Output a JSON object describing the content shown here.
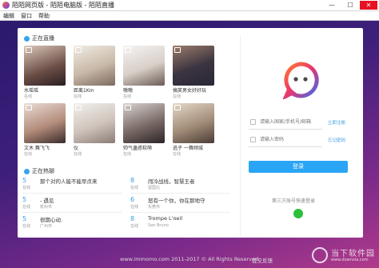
{
  "window": {
    "title": "陌陌网页版 - 陌陌电脑版 - 陌陌直播",
    "min": "—",
    "max": "☐",
    "close": "✕"
  },
  "menu": [
    "编辑",
    "窗口",
    "帮助"
  ],
  "live": {
    "title": "正在直播",
    "items": [
      {
        "name": "水瑶瑶",
        "sub": "在线"
      },
      {
        "name": "距离1Km",
        "sub": "在线"
      },
      {
        "name": "嗷嗷",
        "sub": "在线"
      },
      {
        "name": "搞笑男女好好玩",
        "sub": "在线"
      },
      {
        "name": "文木 舞飞飞",
        "sub": "在线"
      },
      {
        "name": "仪",
        "sub": "在线"
      },
      {
        "name": "帅气蛊惑软萌",
        "sub": "在线"
      },
      {
        "name": "逃子 一舞倾城",
        "sub": "在线"
      }
    ]
  },
  "hot": {
    "title": "正在热聊",
    "rows": [
      {
        "num": "5",
        "unit": "在线",
        "text": "那个对的人能不能早点来",
        "loc": ""
      },
      {
        "num": "8",
        "unit": "在线",
        "text": "闯冷战线，智慧王者",
        "loc": "留国北"
      },
      {
        "num": "5",
        "unit": "在线",
        "text": "- 遇见",
        "loc": "杭州市"
      },
      {
        "num": "6",
        "unit": "在线",
        "text": "怒有一个你，你在那地守",
        "loc": "东莞市"
      },
      {
        "num": "5",
        "unit": "在线",
        "text": "很期心动.",
        "loc": "广州市"
      },
      {
        "num": "8",
        "unit": "在线",
        "text": "Trompe L'oeil",
        "loc": "San Bruno"
      }
    ]
  },
  "login": {
    "phone_placeholder": "请输入国家/手机号/邮箱",
    "password_placeholder": "请输入密码",
    "register_link": "立即注册",
    "forgot_link": "忘记密码",
    "login_button": "登录",
    "third_party": "第三方账号快速登录"
  },
  "footer": {
    "copyright": "www.immomo.com 2011-2017 © All Rights Reserved.",
    "feedback": "提交反馈"
  },
  "watermark": {
    "text": "当下软件园",
    "sub": "www.downxia.com"
  },
  "colors": {
    "accent": "#2aa5f5",
    "wechat": "#2bbf3c"
  }
}
